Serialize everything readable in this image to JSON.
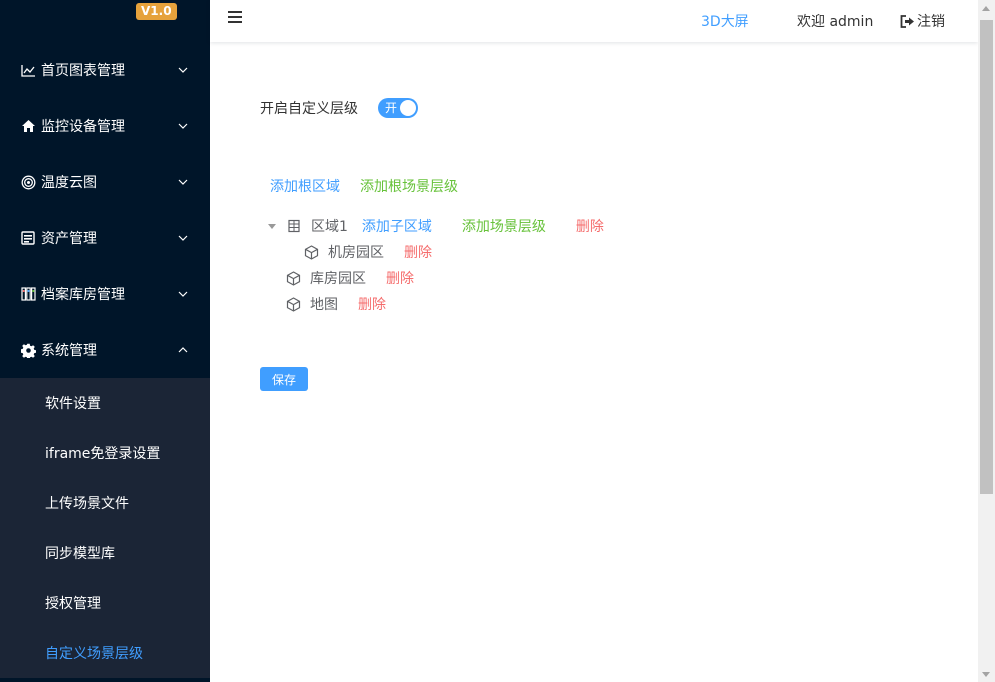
{
  "brand": {
    "version": "V1.0"
  },
  "sidebar": {
    "items": [
      {
        "label": "首页图表管理",
        "icon": "line-chart-icon",
        "expanded": false
      },
      {
        "label": "监控设备管理",
        "icon": "home-icon",
        "expanded": false
      },
      {
        "label": "温度云图",
        "icon": "target-icon",
        "expanded": false
      },
      {
        "label": "资产管理",
        "icon": "asset-icon",
        "expanded": false
      },
      {
        "label": "档案库房管理",
        "icon": "archive-icon",
        "expanded": false
      },
      {
        "label": "系统管理",
        "icon": "gear-icon",
        "expanded": true
      }
    ],
    "submenu": [
      {
        "label": "软件设置",
        "active": false
      },
      {
        "label": "iframe免登录设置",
        "active": false
      },
      {
        "label": "上传场景文件",
        "active": false
      },
      {
        "label": "同步模型库",
        "active": false
      },
      {
        "label": "授权管理",
        "active": false
      },
      {
        "label": "自定义场景层级",
        "active": true
      }
    ]
  },
  "header": {
    "screen_link": "3D大屏",
    "welcome": "欢迎 admin",
    "logout": "注销"
  },
  "main": {
    "toggle_label": "开启自定义层级",
    "toggle_text": "开",
    "toggle_on": true,
    "add_root_area": "添加根区域",
    "add_root_scene": "添加根场景层级",
    "tree": {
      "node1": {
        "label": "区域1",
        "add_child_area": "添加子区域",
        "add_scene": "添加场景层级",
        "delete": "删除"
      },
      "node1_child": {
        "label": "机房园区",
        "delete": "删除"
      },
      "node2": {
        "label": "库房园区",
        "delete": "删除"
      },
      "node3": {
        "label": "地图",
        "delete": "删除"
      }
    },
    "save": "保存"
  },
  "colors": {
    "sidebar_bg": "#001529",
    "submenu_bg": "#1b2536",
    "accent": "#409eff",
    "success": "#67c23a",
    "danger": "#f56c6c",
    "badge": "#e6a23c"
  }
}
